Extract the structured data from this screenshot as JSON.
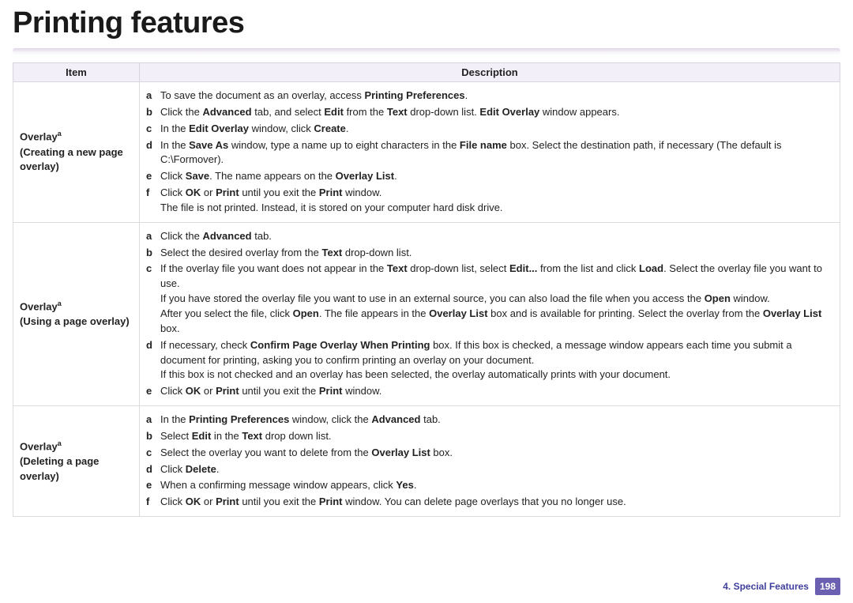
{
  "title": "Printing features",
  "table": {
    "headers": {
      "item": "Item",
      "description": "Description"
    },
    "rows": [
      {
        "item_name": "Overlay",
        "item_sup": "a",
        "item_sub": "(Creating a new page overlay)",
        "steps": [
          {
            "b": "a",
            "html": "To save the document as an overlay, access <b>Printing Preferences</b>."
          },
          {
            "b": "b",
            "html": "Click the <b>Advanced</b> tab, and select <b>Edit</b> from the <b>Text</b> drop-down list. <b>Edit Overlay</b> window appears."
          },
          {
            "b": "c",
            "html": "In the <b>Edit Overlay</b> window, click <b>Create</b>."
          },
          {
            "b": "d",
            "html": "In the <b>Save As</b> window, type a name up to eight characters in the <b>File name</b> box. Select the destination path, if necessary (The default is C:\\Formover)."
          },
          {
            "b": "e",
            "html": "Click <b>Save</b>. The name appears on the <b>Overlay List</b>."
          },
          {
            "b": "f",
            "html": "Click <b>OK</b> or <b>Print</b> until you exit the <b>Print</b> window.<span class=\"indent\">The file is not printed. Instead, it is stored on your computer hard disk drive.</span>"
          }
        ]
      },
      {
        "item_name": "Overlay",
        "item_sup": "a",
        "item_sub": "(Using a page overlay)",
        "steps": [
          {
            "b": "a",
            "html": "Click the <b>Advanced</b> tab."
          },
          {
            "b": "b",
            "html": "Select the desired overlay from the <b>Text</b> drop-down list."
          },
          {
            "b": "c",
            "html": "If the overlay file you want does not appear in the <b>Text</b> drop-down list, select <b>Edit...</b> from the list and click <b>Load</b>. Select the overlay file you want to use.<span class=\"indent\">If you have stored the overlay file you want to use in an external source, you can also load the file when you access the <b>Open</b> window.</span><span class=\"indent\">After you select the file, click <b>Open</b>. The file appears in the <b>Overlay List</b> box and is available for printing. Select the overlay from the <b>Overlay List</b> box.</span>"
          },
          {
            "b": "d",
            "html": "If necessary, check <b>Confirm Page Overlay When Printing</b> box. If this box is checked, a message window appears each time you submit a document for printing, asking you to confirm printing an overlay on your document.<span class=\"indent\">If this box is not checked and an overlay has been selected, the overlay automatically prints with your document.</span>"
          },
          {
            "b": "e",
            "html": "Click <b>OK</b> or <b>Print</b> until you exit the <b>Print</b> window."
          }
        ]
      },
      {
        "item_name": "Overlay",
        "item_sup": "a",
        "item_sub": "(Deleting a page overlay)",
        "steps": [
          {
            "b": "a",
            "html": "In the <b>Printing Preferences</b> window, click the <b>Advanced</b> tab."
          },
          {
            "b": "b",
            "html": "Select <b>Edit</b> in the <b>Text</b> drop down list."
          },
          {
            "b": "c",
            "html": "Select the overlay you want to delete from the <b>Overlay List</b> box."
          },
          {
            "b": "d",
            "html": "Click <b>Delete</b>."
          },
          {
            "b": "e",
            "html": "When a confirming message window appears, click <b>Yes</b>."
          },
          {
            "b": "f",
            "html": "Click <b>OK</b> or <b>Print</b> until you exit the <b>Print</b> window. You can delete page overlays that you no longer use."
          }
        ]
      }
    ]
  },
  "footer": {
    "chapter": "4.  Special Features",
    "page": "198"
  }
}
